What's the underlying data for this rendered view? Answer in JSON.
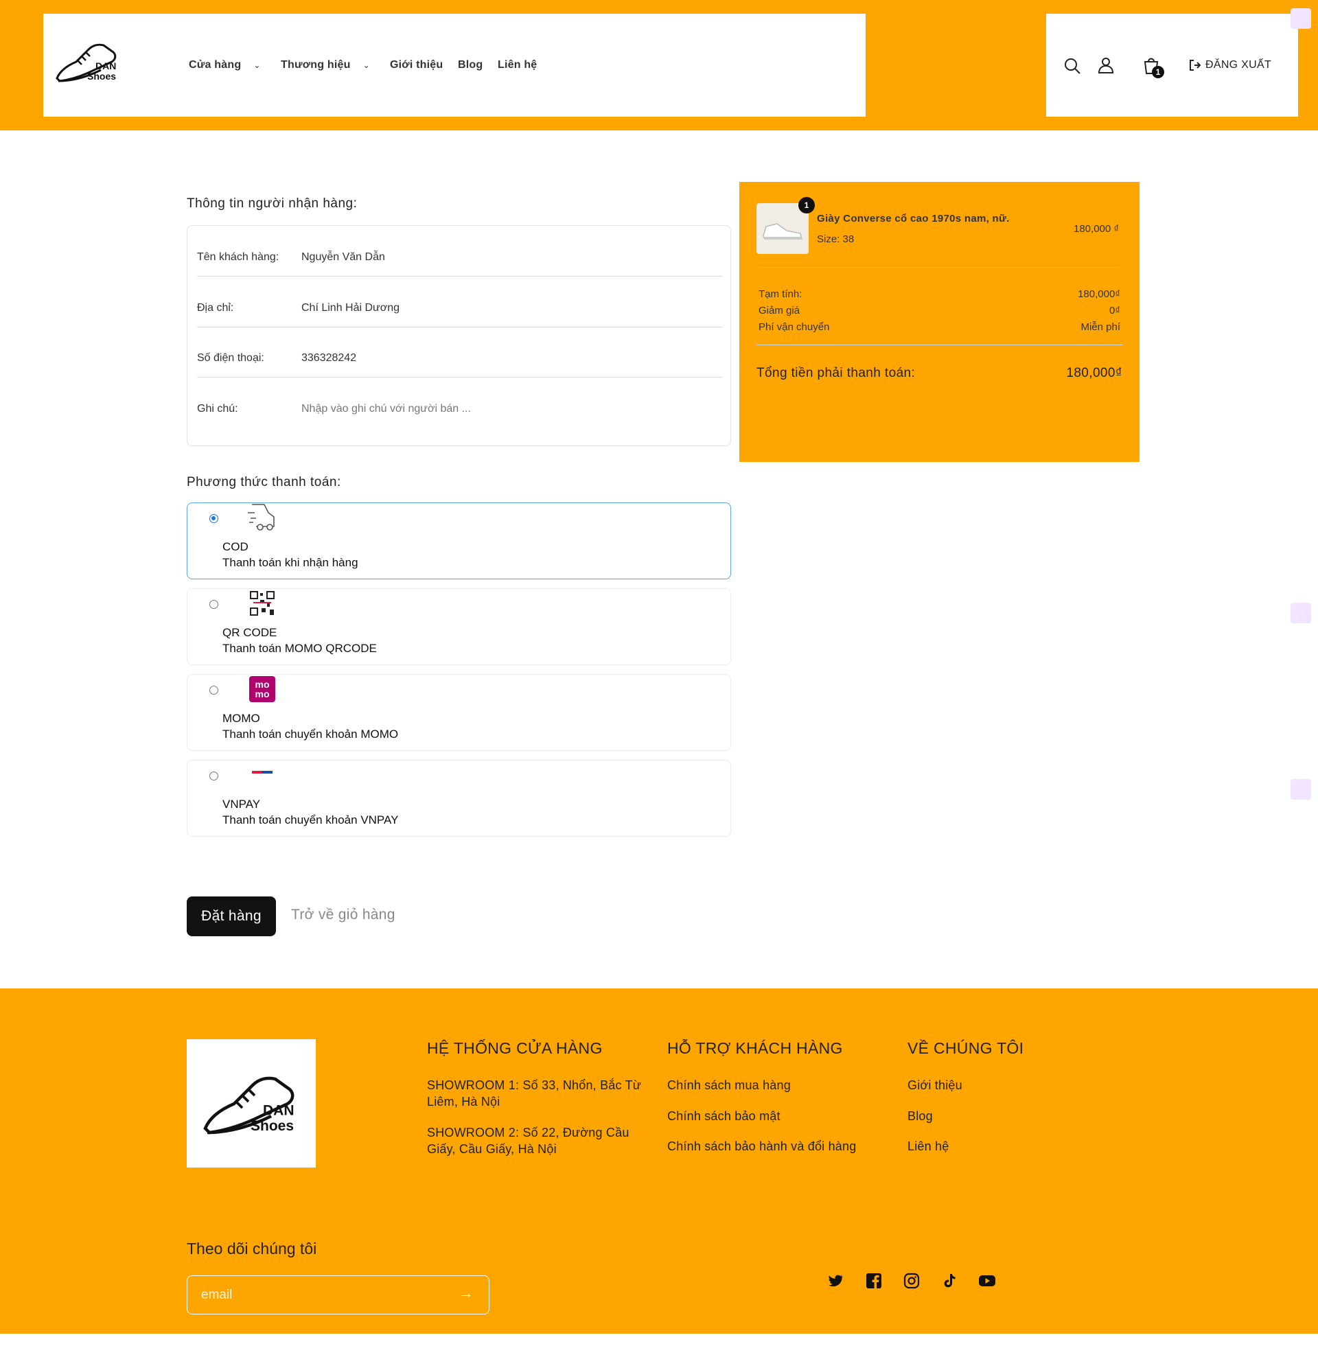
{
  "header": {
    "logo_text": "DAN Shoes",
    "nav": [
      {
        "label": "Cửa hàng",
        "has_dropdown": true
      },
      {
        "label": "Thương hiệu",
        "has_dropdown": true
      },
      {
        "label": "Giới thiệu",
        "has_dropdown": false
      },
      {
        "label": "Blog",
        "has_dropdown": false
      },
      {
        "label": "Liên hệ",
        "has_dropdown": false
      }
    ],
    "cart_count": "1",
    "logout_label": "ĐĂNG XUẤT"
  },
  "recipient": {
    "title": "Thông tin người nhận hàng:",
    "name_label": "Tên khách hàng:",
    "name_value": "Nguyễn Văn Dẫn",
    "address_label": "Địa chỉ:",
    "address_value": "Chí Linh Hải Dương",
    "phone_label": "Số điện thoại:",
    "phone_value": "336328242",
    "note_label": "Ghi chú:",
    "note_placeholder": "Nhập vào ghi chú với người bán ..."
  },
  "payment": {
    "title": "Phương thức thanh toán:",
    "selected": "COD",
    "methods": [
      {
        "name": "COD",
        "desc": "Thanh toán khi nhận hàng",
        "icon": "delivery-truck-icon"
      },
      {
        "name": "QR CODE",
        "desc": "Thanh toán MOMO QRCODE",
        "icon": "qr-code-icon"
      },
      {
        "name": "MOMO",
        "desc": "Thanh toán chuyển khoản MOMO",
        "icon": "momo-logo-icon"
      },
      {
        "name": "VNPAY",
        "desc": "Thanh toán chuyển khoản VNPAY",
        "icon": "vnpay-logo-icon"
      }
    ]
  },
  "actions": {
    "order_label": "Đặt hàng",
    "back_label": "Trở về giỏ hàng"
  },
  "summary": {
    "item": {
      "qty": "1",
      "name": "Giày Converse cổ cao 1970s nam, nữ.",
      "size": "Size: 38",
      "price": "180,000 ₫"
    },
    "subtotal_label": "Tạm tính:",
    "subtotal_value": "180,000₫",
    "discount_label": "Giảm giá",
    "discount_value": "0₫",
    "shipping_label": "Phí vận chuyển",
    "shipping_value": "Miễn phí",
    "total_label": "Tổng tiền phải thanh toán:",
    "total_value": "180,000₫"
  },
  "footer": {
    "stores_title": "HỆ THỐNG CỬA HÀNG",
    "stores": [
      "SHOWROOM 1: Số 33, Nhổn, Bắc Từ Liêm, Hà Nội",
      "SHOWROOM 2: Số 22, Đường Cầu Giấy, Cầu Giấy, Hà Nội"
    ],
    "support_title": "HỖ TRỢ KHÁCH HÀNG",
    "support": [
      "Chính sách mua hàng",
      "Chính sách bảo mật",
      "Chính sách bảo hành và đổi hàng"
    ],
    "about_title": "VỀ CHÚNG TÔI",
    "about": [
      "Giới thiệu",
      "Blog",
      "Liên hệ"
    ],
    "follow_title": "Theo dõi chúng tôi",
    "email_placeholder": "email",
    "social": [
      "twitter-icon",
      "facebook-icon",
      "instagram-icon",
      "tiktok-icon",
      "youtube-icon"
    ]
  },
  "colors": {
    "brand": "#FFA500",
    "button": "#121212",
    "selected_border": "#5aa7e6"
  }
}
